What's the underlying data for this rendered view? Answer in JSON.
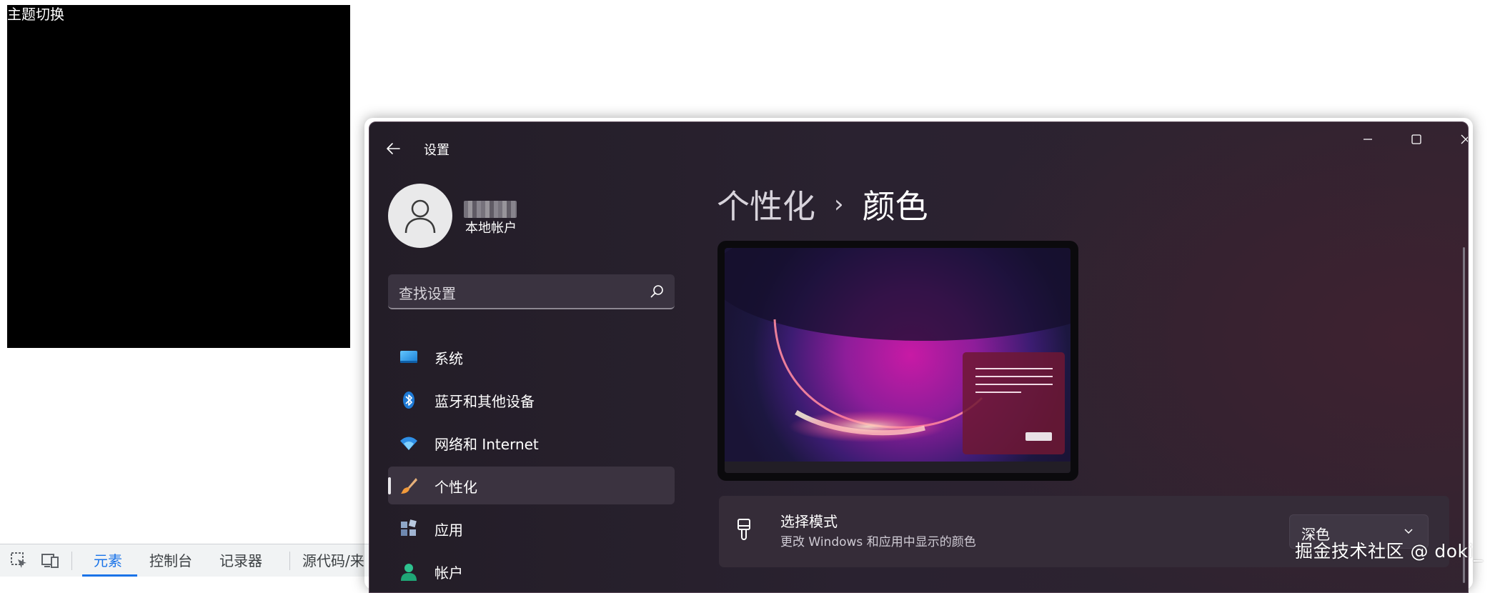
{
  "demo": {
    "label": "主题切换"
  },
  "devtools": {
    "tabs": [
      "元素",
      "控制台",
      "记录器",
      "源代码/来"
    ],
    "active_tab": "元素"
  },
  "window": {
    "title": "设置",
    "account": {
      "type": "本地帐户"
    },
    "search": {
      "placeholder": "查找设置"
    },
    "nav": [
      {
        "label": "系统",
        "icon": "monitor-icon"
      },
      {
        "label": "蓝牙和其他设备",
        "icon": "bluetooth-icon"
      },
      {
        "label": "网络和 Internet",
        "icon": "wifi-icon"
      },
      {
        "label": "个性化",
        "icon": "brush-icon",
        "active": true
      },
      {
        "label": "应用",
        "icon": "apps-icon"
      },
      {
        "label": "帐户",
        "icon": "person-icon"
      }
    ],
    "breadcrumb": {
      "parent": "个性化",
      "separator": "›",
      "current": "颜色"
    },
    "mode": {
      "title": "选择模式",
      "description": "更改 Windows 和应用中显示的颜色",
      "value": "深色"
    }
  },
  "watermark": "掘金技术社区 @ doki_",
  "colors": {
    "accent_devtools": "#1a73e8",
    "window_bg": "#2a2230",
    "card_bg": "#352c38"
  }
}
